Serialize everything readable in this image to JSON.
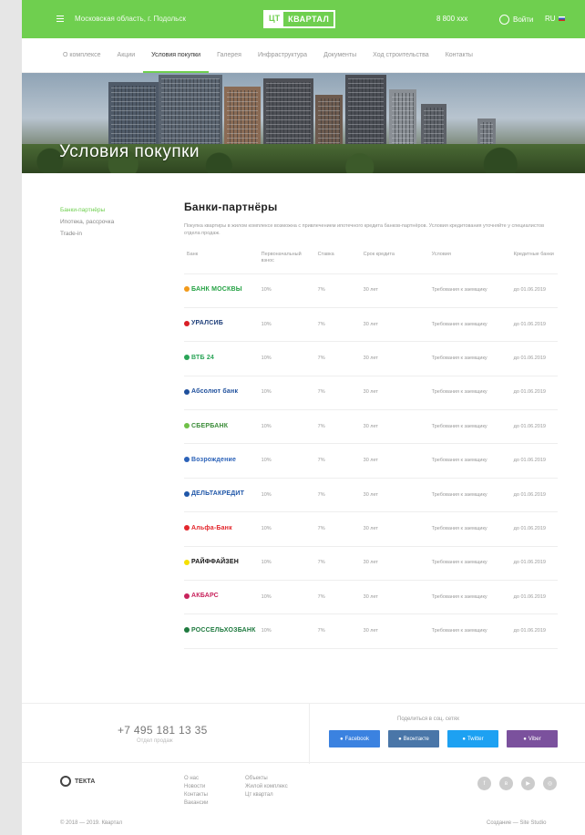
{
  "header": {
    "city": "Московская область, г. Подольск",
    "logo_mark": "ЦТ",
    "logo_word": "КВАРТАЛ",
    "phone": "8 800 ххх",
    "login": "Войти",
    "lang": "RU"
  },
  "nav": [
    "О комплексе",
    "Акции",
    "Условия покупки",
    "Галерея",
    "Инфраструктура",
    "Документы",
    "Ход строительства",
    "Контакты"
  ],
  "hero": {
    "title": "Условия покупки"
  },
  "sidebar": [
    "Банки-партнёры",
    "Ипотека, рассрочка",
    "Trade-in"
  ],
  "main": {
    "title": "Банки-партнёры",
    "intro": "Покупка квартиры в жилом комплексе возможна с привлечением ипотечного кредита банков-партнёров. Условия кредитования уточняйте у специалистов отдела продаж.",
    "headers": [
      "Банк",
      "Первоначальный взнос",
      "Ставка",
      "Срок кредита",
      "Условия",
      "Кредитные банки"
    ],
    "rows": [
      {
        "bank": "БАНК МОСКВЫ",
        "color": "#25a244",
        "icon": "#f29a1a",
        "down": "10%",
        "rate": "7%",
        "term": "30 лет",
        "cond": "Требования к заемщику",
        "until": "до 01.06.2019"
      },
      {
        "bank": "УРАЛСИБ",
        "color": "#1f3f7a",
        "icon": "#d91f26",
        "down": "10%",
        "rate": "7%",
        "term": "30 лет",
        "cond": "Требования к заемщику",
        "until": "до 01.06.2019"
      },
      {
        "bank": "ВТБ 24",
        "color": "#2aa457",
        "icon": "#2aa457",
        "down": "10%",
        "rate": "7%",
        "term": "30 лет",
        "cond": "Требования к заемщику",
        "until": "до 01.06.2019"
      },
      {
        "bank": "Абсолют банк",
        "color": "#1e4f9c",
        "icon": "#1e4f9c",
        "down": "10%",
        "rate": "7%",
        "term": "30 лет",
        "cond": "Требования к заемщику",
        "until": "до 01.06.2019"
      },
      {
        "bank": "СБЕРБАНК",
        "color": "#3c8d3a",
        "icon": "#6fc048",
        "down": "10%",
        "rate": "7%",
        "term": "30 лет",
        "cond": "Требования к заемщику",
        "until": "до 01.06.2019"
      },
      {
        "bank": "Возрождение",
        "color": "#2b62b8",
        "icon": "#2b62b8",
        "down": "10%",
        "rate": "7%",
        "term": "30 лет",
        "cond": "Требования к заемщику",
        "until": "до 01.06.2019"
      },
      {
        "bank": "ДЕЛЬТАКРЕДИТ",
        "color": "#1f56a8",
        "icon": "#1f56a8",
        "down": "10%",
        "rate": "7%",
        "term": "30 лет",
        "cond": "Требования к заемщику",
        "until": "до 01.06.2019"
      },
      {
        "bank": "Альфа-Банк",
        "color": "#e3262c",
        "icon": "#e3262c",
        "down": "10%",
        "rate": "7%",
        "term": "30 лет",
        "cond": "Требования к заемщику",
        "until": "до 01.06.2019"
      },
      {
        "bank": "РАЙФФАЙЗЕН",
        "color": "#111111",
        "icon": "#f5e000",
        "down": "10%",
        "rate": "7%",
        "term": "30 лет",
        "cond": "Требования к заемщику",
        "until": "до 01.06.2019"
      },
      {
        "bank": "АКБАРС",
        "color": "#c8235c",
        "icon": "#c8235c",
        "down": "10%",
        "rate": "7%",
        "term": "30 лет",
        "cond": "Требования к заемщику",
        "until": "до 01.06.2019"
      },
      {
        "bank": "РОССЕЛЬХОЗБАНК",
        "color": "#1f7a3f",
        "icon": "#1f7a3f",
        "down": "10%",
        "rate": "7%",
        "term": "30 лет",
        "cond": "Требования к заемщику",
        "until": "до 01.06.2019"
      }
    ]
  },
  "footer": {
    "phone": "+7 495 181 13 35",
    "phone_sub": "Отдел продаж",
    "share_title": "Поделиться в соц. сетях",
    "shares": [
      {
        "label": "Facebook",
        "color": "#3b82e0"
      },
      {
        "label": "Вконтакте",
        "color": "#4a76a8"
      },
      {
        "label": "Twitter",
        "color": "#1da1f2"
      },
      {
        "label": "Viber",
        "color": "#7b519d"
      }
    ],
    "logo": "ТЕКТА",
    "col1": [
      "О нас",
      "Новости",
      "Контакты",
      "Вакансии"
    ],
    "col2": [
      "Объекты",
      "Жилой комплекс",
      "Цт квартал"
    ],
    "copyright": "© 2018 — 2019. Квартал",
    "developer": "Создание — Site Studio"
  }
}
